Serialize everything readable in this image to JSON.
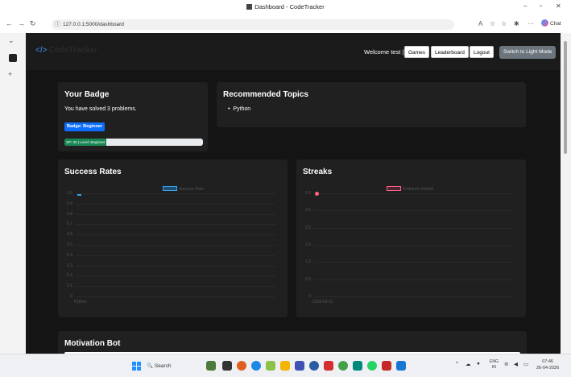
{
  "browser": {
    "window_title": "Dashboard - CodeTracker",
    "url": "127.0.0.1:5000/dashboard",
    "copilot_label": "Chat"
  },
  "nav": {
    "brand": "CodeTracker",
    "welcome": "Welcome test |",
    "buttons": [
      "Games",
      "Leaderboard",
      "Logout"
    ],
    "theme_button": "Switch to Light Mode"
  },
  "badge_card": {
    "title": "Your Badge",
    "solved_text": "You have solved 3 problems.",
    "badge_label": "Badge: Beginner",
    "progress_label": "XP: 30 | Level: Beginner",
    "progress_fraction": 0.3
  },
  "topics_card": {
    "title": "Recommended Topics",
    "items": [
      "Python"
    ]
  },
  "success_card": {
    "title": "Success Rates",
    "legend": "Success Rate"
  },
  "streaks_card": {
    "title": "Streaks",
    "legend": "Problems Solved"
  },
  "motivation_card": {
    "title": "Motivation Bot"
  },
  "chart_data": [
    {
      "type": "bar",
      "title": "Success Rates",
      "categories": [
        "Python"
      ],
      "series": [
        {
          "name": "Success Rate",
          "values": [
            1.0
          ]
        }
      ],
      "ylim": [
        0,
        1.0
      ],
      "yticks": [
        "1.0",
        "0.9",
        "0.8",
        "0.7",
        "0.6",
        "0.5",
        "0.4",
        "0.3",
        "0.2",
        "0.1",
        "0"
      ],
      "color": "#36a2eb",
      "legend_position": "top-center",
      "grid": true
    },
    {
      "type": "line",
      "title": "Streaks",
      "categories": [
        "2026-03-31"
      ],
      "series": [
        {
          "name": "Problems Solved",
          "values": [
            3
          ]
        }
      ],
      "ylim": [
        0,
        3.0
      ],
      "yticks": [
        "3.0",
        "2.5",
        "2.0",
        "1.5",
        "1.0",
        "0.5",
        "0"
      ],
      "color": "#ff6384",
      "legend_position": "top-center",
      "grid": true
    }
  ],
  "taskbar": {
    "search_label": "Search",
    "language": "ENG",
    "region": "IN",
    "time": "07:46",
    "date": "26-04-2026"
  }
}
